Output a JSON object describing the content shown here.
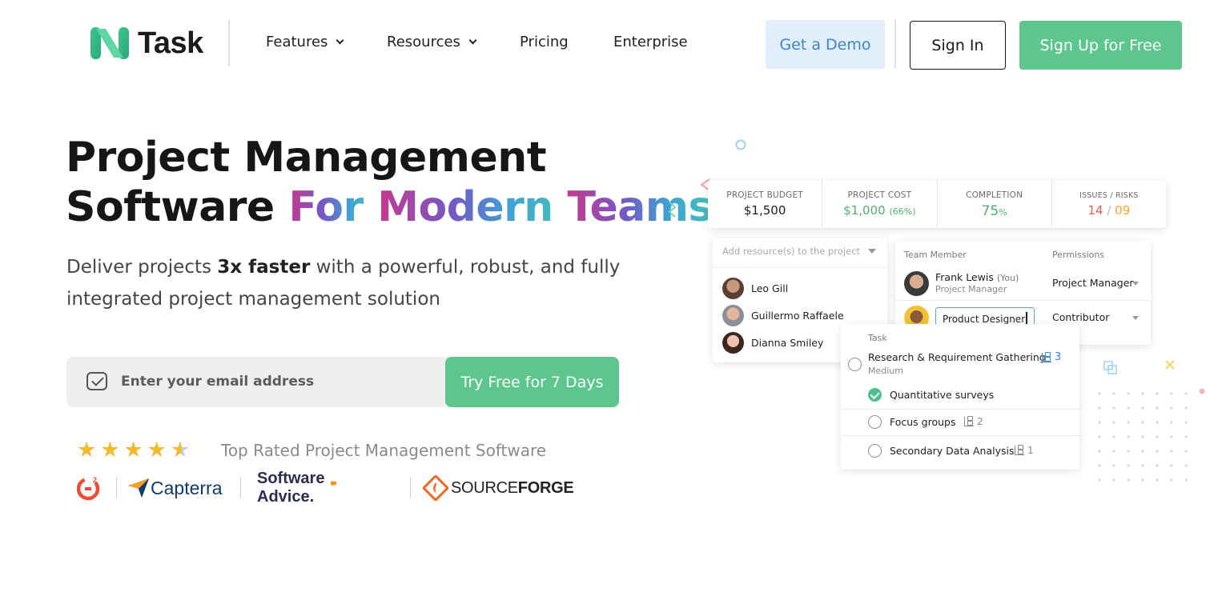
{
  "header": {
    "logo_text": "Task",
    "nav": [
      {
        "label": "Features"
      },
      {
        "label": "Resources"
      },
      {
        "label": "Pricing"
      },
      {
        "label": "Enterprise"
      }
    ],
    "demo_label": "Get a Demo",
    "signin_label": "Sign In",
    "signup_label": "Sign Up for Free"
  },
  "hero": {
    "title_line1": "Project Management",
    "title_line2_plain": "Software ",
    "title_line2_for": "For ",
    "title_line2_modern": "Modern ",
    "title_line2_teams": "Teams",
    "subtitle_pre": "Deliver projects ",
    "subtitle_bold": "3x faster",
    "subtitle_post": " with a powerful, robust, and fully integrated project management solution",
    "email_placeholder": "Enter your email address",
    "cta_label": "Try Free for 7 Days",
    "rating": 4.5,
    "rating_text": "Top Rated Project Management Software",
    "brands": {
      "g2": "G2",
      "capterra": "Capterra",
      "software_advice": "Software Advice.",
      "sourceforge_light": "SOURCE",
      "sourceforge_bold": "FORGE"
    }
  },
  "mockup": {
    "stats": [
      {
        "label": "PROJECT BUDGET",
        "value": "$1,500",
        "extra": "",
        "color": "#1f1f1f"
      },
      {
        "label": "PROJECT COST",
        "value": "$1,000",
        "extra": "(66%)",
        "color": "#4fb36d"
      },
      {
        "label": "COMPLETION",
        "value": "75",
        "extra": "%",
        "color": "#4fb36d"
      },
      {
        "label": "ISSUES / RISKS",
        "value": "14",
        "extra": "09",
        "sep": " / ",
        "color": "#f0594c",
        "extra_color": "#f5a623"
      }
    ],
    "resources": {
      "placeholder": "Add resource(s) to the project",
      "people": [
        "Leo Gill",
        "Guillermo Raffaele",
        "Dianna Smiley"
      ]
    },
    "team": {
      "col_member": "Team Member",
      "col_permissions": "Permissions",
      "rows": [
        {
          "name": "Frank Lewis",
          "you": "(You)",
          "role": "Project Manager",
          "permission": "Project Manager"
        },
        {
          "role_input": "Product Designer",
          "permission": "Contributor"
        }
      ]
    },
    "tasks": {
      "col_task": "Task",
      "items": [
        {
          "title": "Research & Requirement Gathering",
          "priority": "Medium",
          "subtasks": "3",
          "done": false
        },
        {
          "title": "Quantitative surveys",
          "subtasks": "",
          "done": true
        },
        {
          "title": "Focus groups",
          "subtasks": "2",
          "done": false
        },
        {
          "title": "Secondary Data Analysis",
          "subtasks": "1",
          "done": false
        }
      ]
    }
  },
  "colors": {
    "brand_green": "#5cc68d",
    "demo_bg": "#e2eefb",
    "demo_text": "#3a86cf",
    "star": "#f5b92b"
  }
}
